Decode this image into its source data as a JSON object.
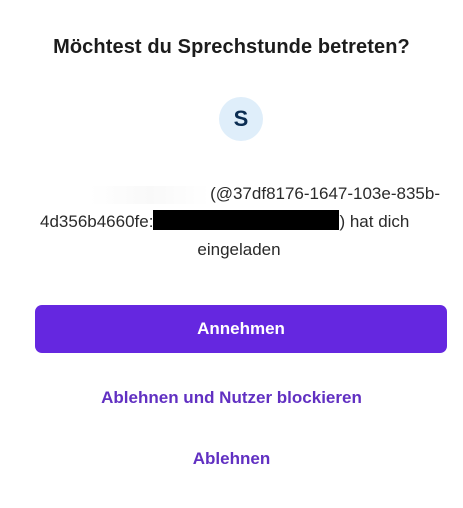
{
  "dialog": {
    "title": "Möchtest du Sprechstunde betreten?",
    "avatar_initial": "S",
    "message": {
      "line1_suffix": "(@37df8176-1647-103e-835b-",
      "line2_prefix": "4d356b4660fe:",
      "line2_suffix": ") hat dich",
      "line3": "eingeladen"
    },
    "accept_label": "Annehmen",
    "decline_block_label": "Ablehnen und Nutzer blockieren",
    "decline_label": "Ablehnen"
  },
  "colors": {
    "accent": "#6527e0",
    "link": "#6130c2",
    "avatar_bg": "#dfeefa",
    "avatar_text": "#0b2d52"
  }
}
